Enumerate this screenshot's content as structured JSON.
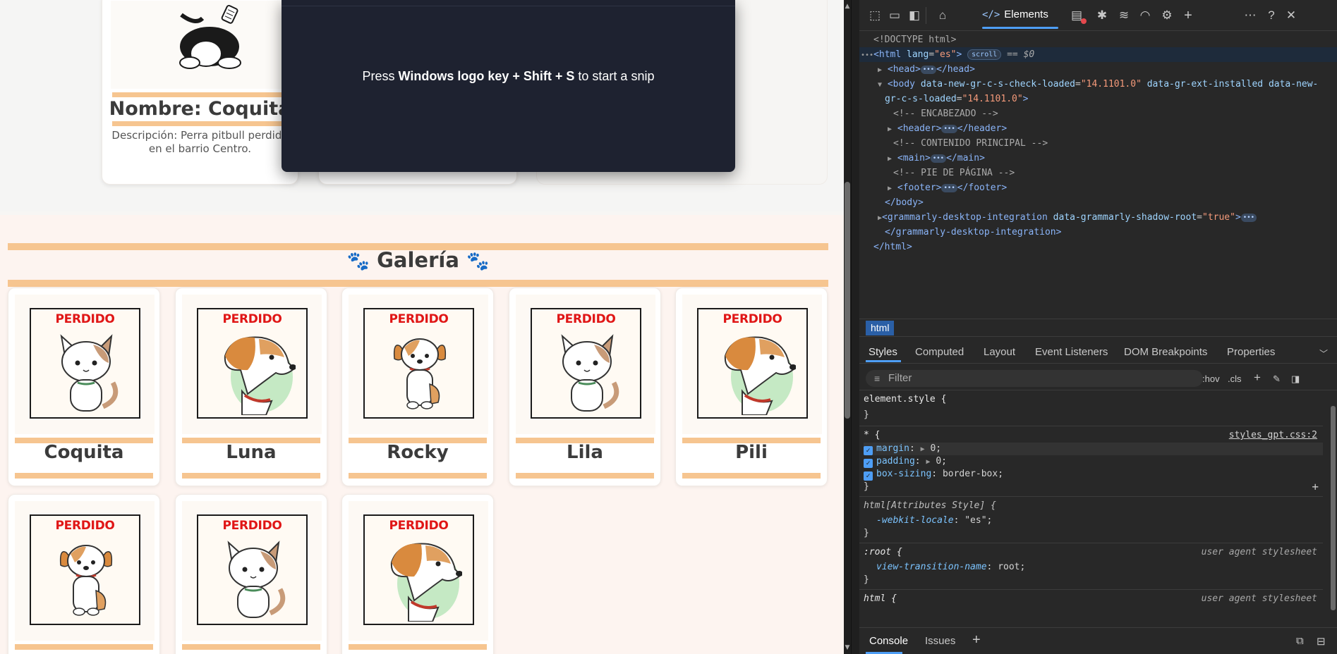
{
  "top_card": {
    "name": "Nombre: Coquita",
    "description_line1": "Descripción: Perra pitbull perdida",
    "description_line2": "en el barrio Centro."
  },
  "snip_overlay": {
    "prefix": "Press ",
    "keys": "Windows logo key + Shift + S",
    "suffix": " to start a snip"
  },
  "gallery": {
    "title": "Galería",
    "paw_glyph": "🐾",
    "lost_label": "PERDIDO",
    "cards": [
      {
        "name": "Coquita",
        "animal": "cat"
      },
      {
        "name": "Luna",
        "animal": "dog-big"
      },
      {
        "name": "Rocky",
        "animal": "puppy"
      },
      {
        "name": "Lila",
        "animal": "cat"
      },
      {
        "name": "Pili",
        "animal": "dog-big"
      },
      {
        "name": "",
        "animal": "puppy"
      },
      {
        "name": "",
        "animal": "cat"
      },
      {
        "name": "",
        "animal": "dog-big"
      }
    ]
  },
  "devtools": {
    "active_tool": "Elements",
    "dom": {
      "doctype": "<!DOCTYPE html>",
      "html_open": "html",
      "html_lang_attr": "lang",
      "html_lang_val": "\"es\"",
      "scroll_pill": "scroll",
      "dollar0": "== $0",
      "head": "head",
      "body_attr1": "data-new-gr-c-s-check-loaded",
      "body_val1": "\"14.1101.0\"",
      "body_attr2": "data-gr-ext-installed",
      "body_attr3_a": "data-new-",
      "body_attr3_b": "gr-c-s-loaded",
      "body_val3": "\"14.1101.0\"",
      "comment_header": "<!-- ENCABEZADO -->",
      "header": "header",
      "comment_main": "<!-- CONTENIDO PRINCIPAL -->",
      "main": "main",
      "comment_footer": "<!-- PIE DE PÁGINA -->",
      "footer": "footer",
      "body_close": "</body>",
      "grammarly_tag": "grammarly-desktop-integration",
      "grammarly_attr": "data-grammarly-shadow-root",
      "grammarly_val": "\"true\"",
      "grammarly_close": "</grammarly-desktop-integration>",
      "html_close": "</html>"
    },
    "breadcrumb": "html",
    "panel_tabs": [
      "Styles",
      "Computed",
      "Layout",
      "Event Listeners",
      "DOM Breakpoints",
      "Properties"
    ],
    "filter_placeholder": "Filter",
    "filter_hov": ":hov",
    "filter_cls": ".cls",
    "styles": {
      "element_style": "element.style {",
      "close": "}",
      "universal": "* {",
      "source": "styles_gpt.css:2",
      "margin_prop": "margin",
      "margin_val": "0;",
      "padding_prop": "padding",
      "padding_val": "0;",
      "boxsizing_prop": "box-sizing",
      "boxsizing_val": "border-box;",
      "html_attr_sel": "html[Attributes Style] {",
      "locale_prop": "-webkit-locale",
      "locale_val": "\"es\";",
      "root_sel": ":root {",
      "ua_label": "user agent stylesheet",
      "vtn_prop": "view-transition-name",
      "vtn_val": "root;",
      "html_sel": "html {"
    },
    "drawer_tabs": [
      "Console",
      "Issues"
    ]
  },
  "colors": {
    "accent_bar": "#f6c590",
    "lost_red": "#e01616",
    "devtools_blue": "#4e9ef5"
  }
}
